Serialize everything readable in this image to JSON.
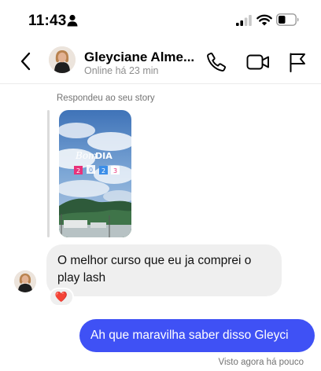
{
  "status_bar": {
    "time": "11:43",
    "icons": [
      "person-icon",
      "signal-icon",
      "wifi-icon",
      "battery-icon"
    ]
  },
  "header": {
    "contact_name": "Gleyciane Alme...",
    "contact_status": "Online há 23 min",
    "icons": [
      "back-arrow-icon",
      "phone-icon",
      "video-camera-icon",
      "flag-icon"
    ]
  },
  "conversation": {
    "story_reply_label": "Respondeu ao seu story",
    "story_image": {
      "text": "Bom DIA",
      "tiles": [
        "2",
        "0",
        "2",
        "3"
      ]
    },
    "incoming_message": {
      "text": "O melhor curso que eu ja comprei o play lash",
      "reaction": "❤️"
    },
    "outgoing_message": {
      "text": "Ah que maravilha saber disso Gleyci",
      "seen": "Visto agora há pouco"
    }
  },
  "colors": {
    "outgoing_bubble": "#3f51f5",
    "incoming_bubble": "#efefef",
    "secondary_text": "#8e8e8e"
  }
}
